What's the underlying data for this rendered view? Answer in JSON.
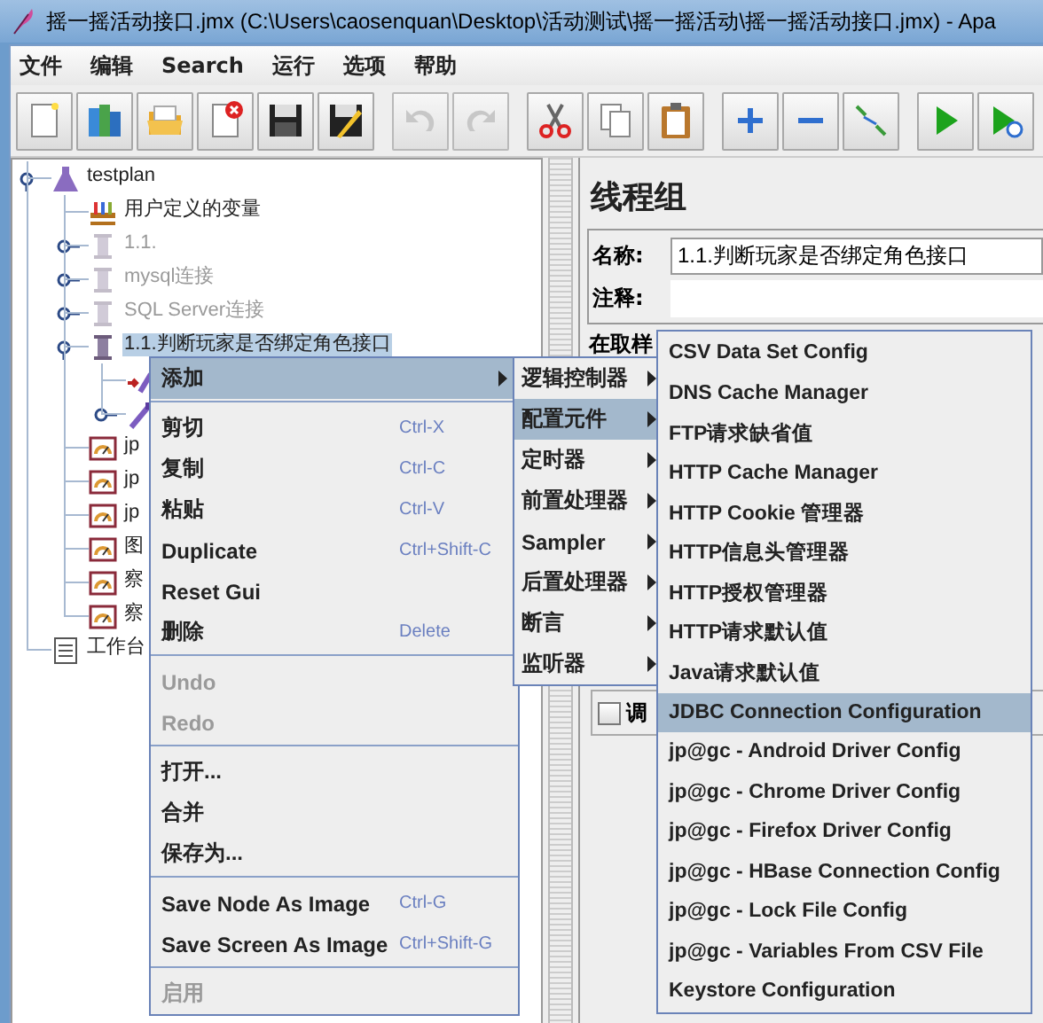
{
  "window": {
    "title": "摇一摇活动接口.jmx (C:\\Users\\caosenquan\\Desktop\\活动测试\\摇一摇活动\\摇一摇活动接口.jmx) - Apa"
  },
  "menu_bar": [
    "文件",
    "编辑",
    "Search",
    "运行",
    "选项",
    "帮助"
  ],
  "toolbar": {
    "groups": [
      [
        {
          "kind": "new",
          "disabled": false
        },
        {
          "kind": "templates",
          "disabled": false
        },
        {
          "kind": "open",
          "disabled": false
        },
        {
          "kind": "close",
          "disabled": false
        },
        {
          "kind": "save",
          "disabled": false
        },
        {
          "kind": "save-as",
          "disabled": false
        }
      ],
      [
        {
          "kind": "undo",
          "disabled": true
        },
        {
          "kind": "redo",
          "disabled": true
        }
      ],
      [
        {
          "kind": "cut",
          "disabled": false
        },
        {
          "kind": "copy",
          "disabled": false
        },
        {
          "kind": "paste",
          "disabled": false
        }
      ],
      [
        {
          "kind": "expand",
          "disabled": false
        },
        {
          "kind": "collapse",
          "disabled": false
        },
        {
          "kind": "toggle",
          "disabled": false
        }
      ],
      [
        {
          "kind": "start",
          "disabled": false
        },
        {
          "kind": "start-no-pause",
          "disabled": false
        }
      ]
    ]
  },
  "tree": {
    "items": [
      {
        "label": "testplan",
        "kind": "plan",
        "expanded": true,
        "disabled": false,
        "selected": false,
        "children": [
          {
            "label": "用户定义的变量",
            "kind": "variables",
            "disabled": false,
            "selected": false
          },
          {
            "label": "1.1.",
            "kind": "thread-group",
            "expanded": false,
            "disabled": true,
            "selected": false
          },
          {
            "label": "mysql连接",
            "kind": "thread-group",
            "expanded": false,
            "disabled": true,
            "selected": false
          },
          {
            "label": "SQL Server连接",
            "kind": "thread-group",
            "expanded": false,
            "disabled": true,
            "selected": false
          },
          {
            "label": "1.1.判断玩家是否绑定角色接口",
            "kind": "thread-group",
            "expanded": true,
            "disabled": false,
            "selected": true,
            "children": [
              {
                "kind": "sampler-current"
              },
              {
                "kind": "sampler",
                "expanded": false
              }
            ]
          },
          {
            "label": "jp",
            "kind": "listener",
            "disabled": false,
            "selected": false
          },
          {
            "label": "jp",
            "kind": "listener",
            "disabled": false,
            "selected": false
          },
          {
            "label": "jp",
            "kind": "listener",
            "disabled": false,
            "selected": false
          },
          {
            "label": "图",
            "kind": "listener",
            "disabled": false,
            "selected": false
          },
          {
            "label": "察",
            "kind": "listener",
            "disabled": false,
            "selected": false
          },
          {
            "label": "察",
            "kind": "listener",
            "disabled": false,
            "selected": false
          }
        ]
      },
      {
        "label": "工作台",
        "kind": "workbench",
        "disabled": false,
        "selected": false
      }
    ]
  },
  "panel": {
    "title": "线程组",
    "name_label": "名称:",
    "name_value": "1.1.判断玩家是否绑定角色接口",
    "comment_label": "注释:",
    "error_section_label": "在取样",
    "scheduler": {
      "label": "调",
      "checked": false
    }
  },
  "context_menu": {
    "groups": [
      [
        {
          "label": "添加",
          "submenu": true,
          "selected": true,
          "disabled": false
        }
      ],
      [
        {
          "label": "剪切",
          "shortcut": "Ctrl-X",
          "selected": false,
          "disabled": false
        },
        {
          "label": "复制",
          "shortcut": "Ctrl-C",
          "selected": false,
          "disabled": false
        },
        {
          "label": "粘贴",
          "shortcut": "Ctrl-V",
          "selected": false,
          "disabled": false
        },
        {
          "label": "Duplicate",
          "shortcut": "Ctrl+Shift-C",
          "selected": false,
          "disabled": false
        },
        {
          "label": "Reset Gui",
          "selected": false,
          "disabled": false
        },
        {
          "label": "删除",
          "shortcut": "Delete",
          "selected": false,
          "disabled": false
        }
      ],
      [
        {
          "label": "Undo",
          "selected": false,
          "disabled": true
        },
        {
          "label": "Redo",
          "selected": false,
          "disabled": true
        }
      ],
      [
        {
          "label": "打开...",
          "selected": false,
          "disabled": false
        },
        {
          "label": "合并",
          "selected": false,
          "disabled": false
        },
        {
          "label": "保存为...",
          "selected": false,
          "disabled": false
        }
      ],
      [
        {
          "label": "Save Node As Image",
          "shortcut": "Ctrl-G",
          "selected": false,
          "disabled": false
        },
        {
          "label": "Save Screen As Image",
          "shortcut": "Ctrl+Shift-G",
          "selected": false,
          "disabled": false
        }
      ],
      [
        {
          "label": "启用",
          "selected": false,
          "disabled": true
        }
      ]
    ]
  },
  "add_submenu": {
    "items": [
      {
        "label": "逻辑控制器",
        "selected": false
      },
      {
        "label": "配置元件",
        "selected": true
      },
      {
        "label": "定时器",
        "selected": false
      },
      {
        "label": "前置处理器",
        "selected": false
      },
      {
        "label": "Sampler",
        "selected": false
      },
      {
        "label": "后置处理器",
        "selected": false
      },
      {
        "label": "断言",
        "selected": false
      },
      {
        "label": "监听器",
        "selected": false
      }
    ]
  },
  "config_submenu": {
    "items": [
      {
        "label": "CSV Data Set Config",
        "selected": false
      },
      {
        "label": "DNS Cache Manager",
        "selected": false
      },
      {
        "label": "FTP请求缺省值",
        "selected": false
      },
      {
        "label": "HTTP Cache Manager",
        "selected": false
      },
      {
        "label": "HTTP Cookie 管理器",
        "selected": false
      },
      {
        "label": "HTTP信息头管理器",
        "selected": false
      },
      {
        "label": "HTTP授权管理器",
        "selected": false
      },
      {
        "label": "HTTP请求默认值",
        "selected": false
      },
      {
        "label": "Java请求默认值",
        "selected": false
      },
      {
        "label": "JDBC Connection Configuration",
        "selected": true
      },
      {
        "label": "jp@gc - Android Driver Config",
        "selected": false
      },
      {
        "label": "jp@gc - Chrome Driver Config",
        "selected": false
      },
      {
        "label": "jp@gc - Firefox Driver Config",
        "selected": false
      },
      {
        "label": "jp@gc - HBase Connection Config",
        "selected": false
      },
      {
        "label": "jp@gc - Lock File Config",
        "selected": false
      },
      {
        "label": "jp@gc - Variables From CSV File",
        "selected": false
      },
      {
        "label": "Keystore Configuration",
        "selected": false
      }
    ]
  }
}
